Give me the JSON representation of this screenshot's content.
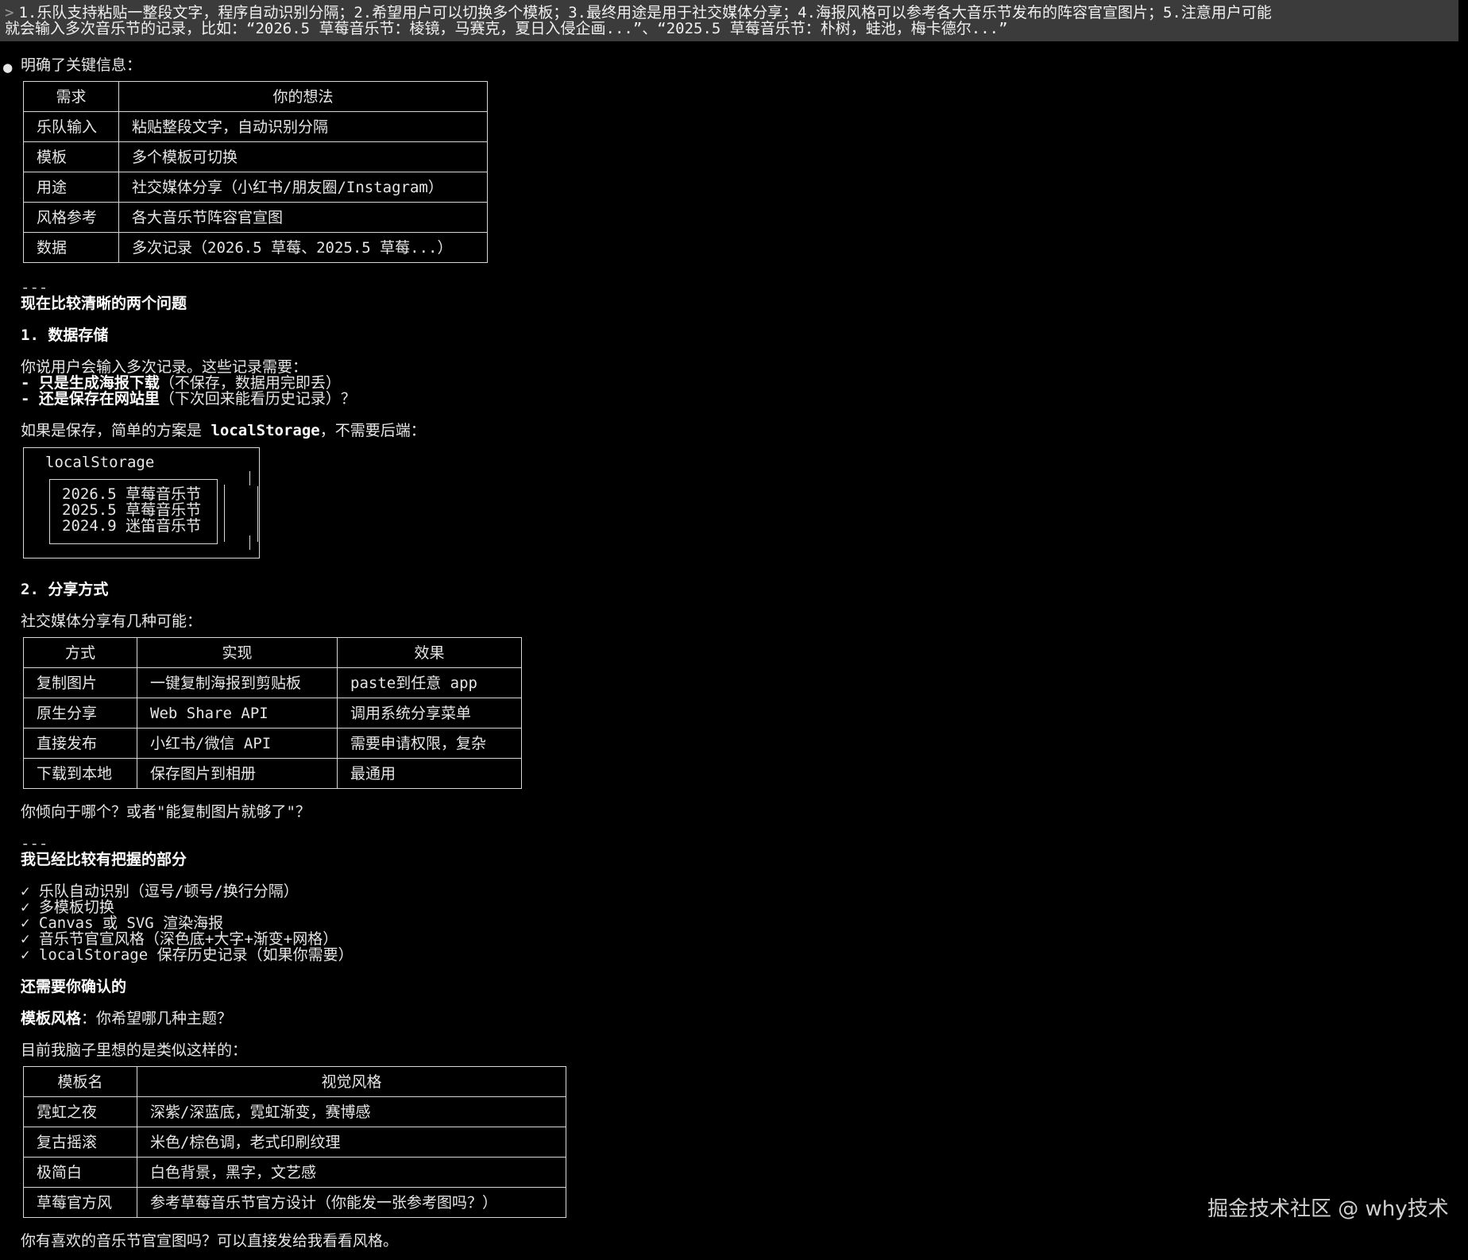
{
  "prompt": {
    "caret": ">",
    "line1": "1.乐队支持粘贴一整段文字，程序自动识别分隔；2.希望用户可以切换多个模板；3.最终用途是用于社交媒体分享；4.海报风格可以参考各大音乐节发布的阵容官宣图片；5.注意用户可能",
    "line2": "就会输入多次音乐节的记录，比如：“2026.5 草莓音乐节：棱镜，马赛克，夏日入侵企画...”、“2025.5 草莓音乐节：朴树，蛙池，梅卡德尔...”"
  },
  "intro": {
    "bullet": "●",
    "text": "明确了关键信息："
  },
  "table1": {
    "headers": [
      "需求",
      "你的想法"
    ],
    "rows": [
      [
        "乐队输入",
        "粘贴整段文字，自动识别分隔"
      ],
      [
        "模板",
        "多个模板可切换"
      ],
      [
        "用途",
        "社交媒体分享（小红书/朋友圈/Instagram）"
      ],
      [
        "风格参考",
        "各大音乐节阵容官宣图"
      ],
      [
        "数据",
        "多次记录（2026.5 草莓、2025.5 草莓...）"
      ]
    ]
  },
  "sep": "---",
  "section1": {
    "title": "现在比较清晰的两个问题",
    "q1_title": "1. 数据存储",
    "q1_intro": "你说用户会输入多次记录。这些记录需要：",
    "opt1_prefix": "- ",
    "opt1_bold": "只是生成海报下载",
    "opt1_rest": "（不保存，数据用完即丢）",
    "opt2_prefix": "- ",
    "opt2_bold": "还是保存在网站里",
    "opt2_rest": "（下次回来能看历史记录）？",
    "ls_pre": "如果是保存，简单的方案是 ",
    "ls_bold": "localStorage",
    "ls_post": "，不需要后端：",
    "ls_box_title": "localStorage",
    "ls_items": [
      "2026.5 草莓音乐节",
      "2025.5 草莓音乐节",
      "2024.9 迷笛音乐节"
    ]
  },
  "section2": {
    "title": "2. 分享方式",
    "intro": "社交媒体分享有几种可能：",
    "headers": [
      "方式",
      "实现",
      "效果"
    ],
    "rows": [
      [
        "复制图片",
        "一键复制海报到剪贴板",
        "paste到任意 app"
      ],
      [
        "原生分享",
        "Web Share API",
        "调用系统分享菜单"
      ],
      [
        "直接发布",
        "小红书/微信 API",
        "需要申请权限，复杂"
      ],
      [
        "下载到本地",
        "保存图片到相册",
        "最通用"
      ]
    ],
    "question": "你倾向于哪个？或者\"能复制图片就够了\"？"
  },
  "section3": {
    "title": "我已经比较有把握的部分",
    "checks": [
      "✓ 乐队自动识别（逗号/顿号/换行分隔）",
      "✓ 多模板切换",
      "✓ Canvas 或 SVG 渲染海报",
      "✓ 音乐节官宣风格（深色底+大字+渐变+网格）",
      "✓ localStorage 保存历史记录（如果你需要）"
    ]
  },
  "section4": {
    "title": "还需要你确认的",
    "tpl_bold": "模板风格",
    "tpl_rest": "：你希望哪几种主题？",
    "current": "目前我脑子里想的是类似这样的：",
    "headers": [
      "模板名",
      "视觉风格"
    ],
    "rows": [
      [
        "霓虹之夜",
        "深紫/深蓝底，霓虹渐变，赛博感"
      ],
      [
        "复古摇滚",
        "米色/棕色调，老式印刷纹理"
      ],
      [
        "极简白",
        "白色背景，黑字，文艺感"
      ],
      [
        "草莓官方风",
        "参考草莓音乐节官方设计（你能发一张参考图吗？）"
      ]
    ],
    "final": "你有喜欢的音乐节官宣图吗？可以直接发给我看看风格。"
  },
  "watermark": "掘金技术社区 @ why技术"
}
